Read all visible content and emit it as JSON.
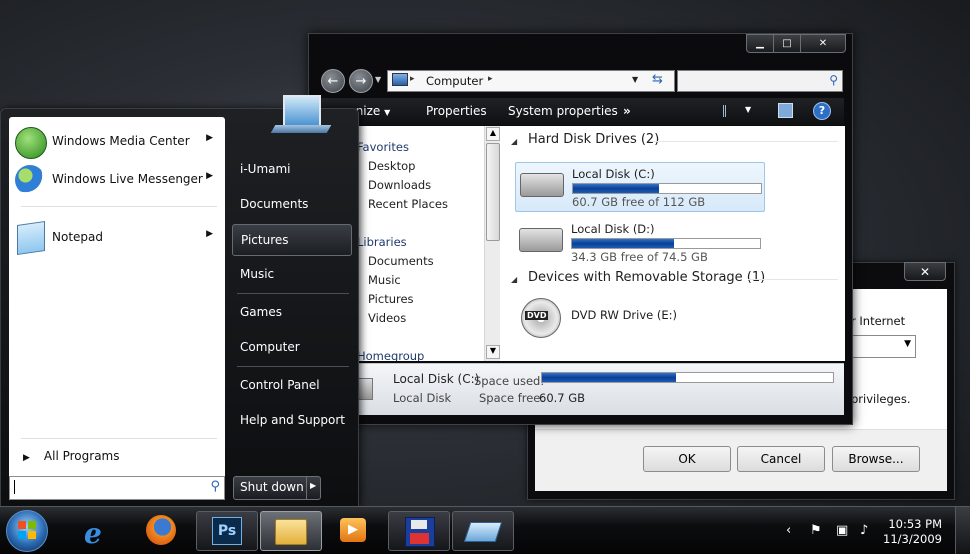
{
  "run_dialog": {
    "text_partial_1": "or Internet",
    "text_partial_2": "privileges.",
    "ok_label": "OK",
    "cancel_label": "Cancel",
    "browse_label": "Browse..."
  },
  "explorer": {
    "address": {
      "crumb": "Computer"
    },
    "toolbar": {
      "organize": "rganize",
      "properties": "Properties",
      "system_properties": "System properties",
      "more": "»"
    },
    "nav_pane": {
      "favorites": "Favorites",
      "desktop": "Desktop",
      "downloads": "Downloads",
      "recent_places": "Recent Places",
      "libraries": "Libraries",
      "documents": "Documents",
      "music": "Music",
      "pictures": "Pictures",
      "videos": "Videos",
      "homegroup": "Homegroup"
    },
    "content": {
      "hdd_header": "Hard Disk Drives (2)",
      "removable_header": "Devices with Removable Storage (1)",
      "drives": [
        {
          "name": "Local Disk (C:)",
          "free": "60.7 GB free of 112 GB",
          "used_fraction": 0.46
        },
        {
          "name": "Local Disk (D:)",
          "free": "34.3 GB free of 74.5 GB",
          "used_fraction": 0.54
        }
      ],
      "dvd": {
        "name": "DVD RW Drive (E:)",
        "badge": "DVD"
      }
    },
    "details": {
      "name": "Local Disk (C:)",
      "type": "Local Disk",
      "space_used_label": "Space used:",
      "space_free_label": "Space free:",
      "space_free_value": "60.7 GB",
      "used_fraction": 0.46
    }
  },
  "start_menu": {
    "programs": {
      "wmc": "Windows Media Center",
      "wlm": "Windows Live Messenger",
      "notepad": "Notepad"
    },
    "all_programs": "All Programs",
    "right": {
      "user": "i-Umami",
      "documents": "Documents",
      "pictures": "Pictures",
      "music": "Music",
      "games": "Games",
      "computer": "Computer",
      "control_panel": "Control Panel",
      "help": "Help and Support"
    },
    "shutdown": "Shut down"
  },
  "taskbar": {
    "photoshop_label": "Ps",
    "time": "10:53 PM",
    "date": "11/3/2009"
  }
}
